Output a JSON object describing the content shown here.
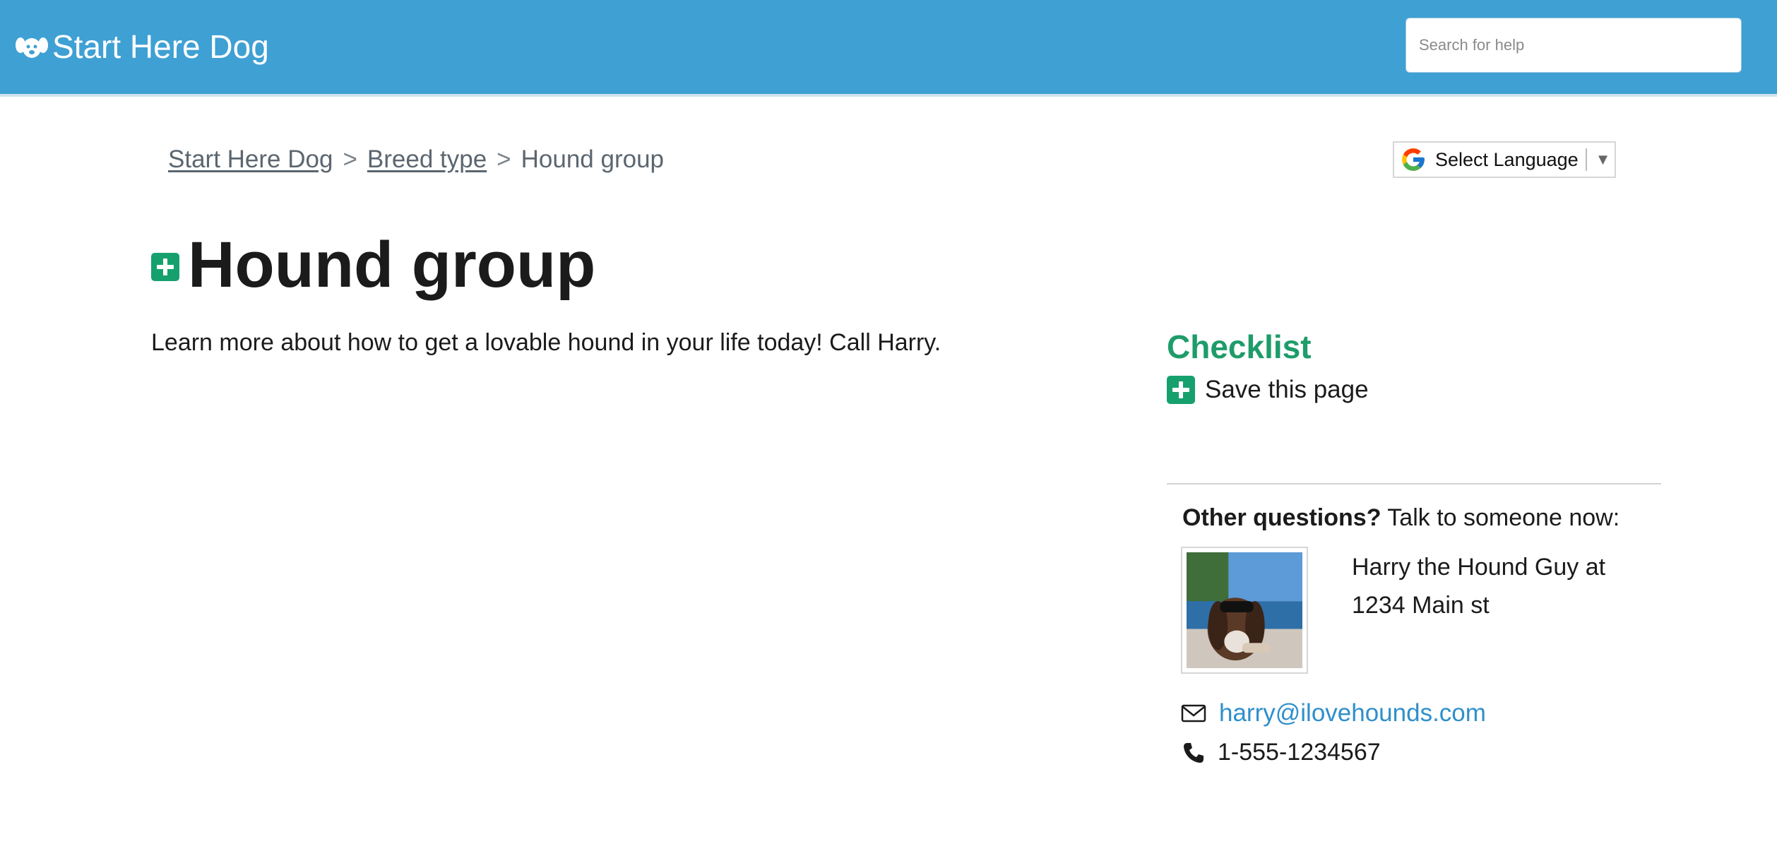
{
  "header": {
    "brand": "Start Here Dog",
    "brand_icon": "dog-paw-icon",
    "search_placeholder": "Search for help",
    "bar_color": "#3fa0d4"
  },
  "breadcrumb": {
    "items": [
      "Start Here Dog",
      "Breed type",
      "Hound group"
    ],
    "separator": ">"
  },
  "language": {
    "label": "Select Language",
    "arrow": "▼",
    "icon": "google-g-icon"
  },
  "page": {
    "title": "Hound group",
    "intro": "Learn more about how to get a lovable hound in your life today! Call Harry."
  },
  "sidebar": {
    "checklist_title": "Checklist",
    "save_label": "Save this page",
    "questions_bold": "Other questions?",
    "questions_rest": " Talk to someone now:",
    "contact_line1": "Harry the Hound Guy at",
    "contact_line2": "1234 Main st",
    "email": "harry@ilovehounds.com",
    "phone": "1-555-1234567",
    "accent_color": "#1e9c6a",
    "link_color": "#2f8fcb"
  }
}
